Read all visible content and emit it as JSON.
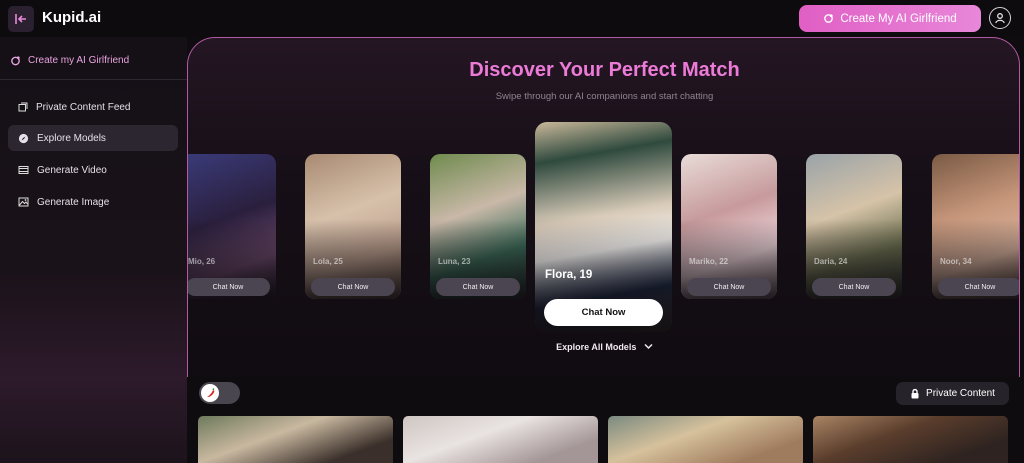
{
  "header": {
    "brand": "Kupid.ai",
    "cta_label": "Create My AI Girlfriend",
    "icons": {
      "back": "collapse-sidebar-icon",
      "cta": "sparkle-icon",
      "profile": "user-avatar-icon"
    }
  },
  "sidebar": {
    "create_label": "Create my AI Girlfriend",
    "items": [
      {
        "label": "Private Content Feed",
        "icon": "feed-icon",
        "active": false
      },
      {
        "label": "Explore Models",
        "icon": "compass-icon",
        "active": true
      },
      {
        "label": "Generate Video",
        "icon": "video-icon",
        "active": false
      },
      {
        "label": "Generate Image",
        "icon": "image-icon",
        "active": false
      }
    ]
  },
  "hero": {
    "title": "Discover Your Perfect Match",
    "subtitle": "Swipe through our AI companions and start chatting",
    "explore_label": "Explore All Models"
  },
  "models": [
    {
      "name": "Mio, 26",
      "chat_label": "Chat Now"
    },
    {
      "name": "Lola, 25",
      "chat_label": "Chat Now"
    },
    {
      "name": "Luna, 23",
      "chat_label": "Chat Now"
    },
    {
      "name": "Flora, 19",
      "chat_label": "Chat Now",
      "featured": true
    },
    {
      "name": "Mariko, 22",
      "chat_label": "Chat Now"
    },
    {
      "name": "Daria, 24",
      "chat_label": "Chat Now"
    },
    {
      "name": "Noor, 34",
      "chat_label": "Chat Now"
    }
  ],
  "feed": {
    "toggle_icon": "chili-pepper-icon",
    "private_label": "Private Content",
    "private_icon": "lock-icon"
  },
  "colors": {
    "accent": "#ec7ad7",
    "cta_gradient": [
      "#e05fc4",
      "#e887d9"
    ],
    "background": "#0d0b0e"
  }
}
